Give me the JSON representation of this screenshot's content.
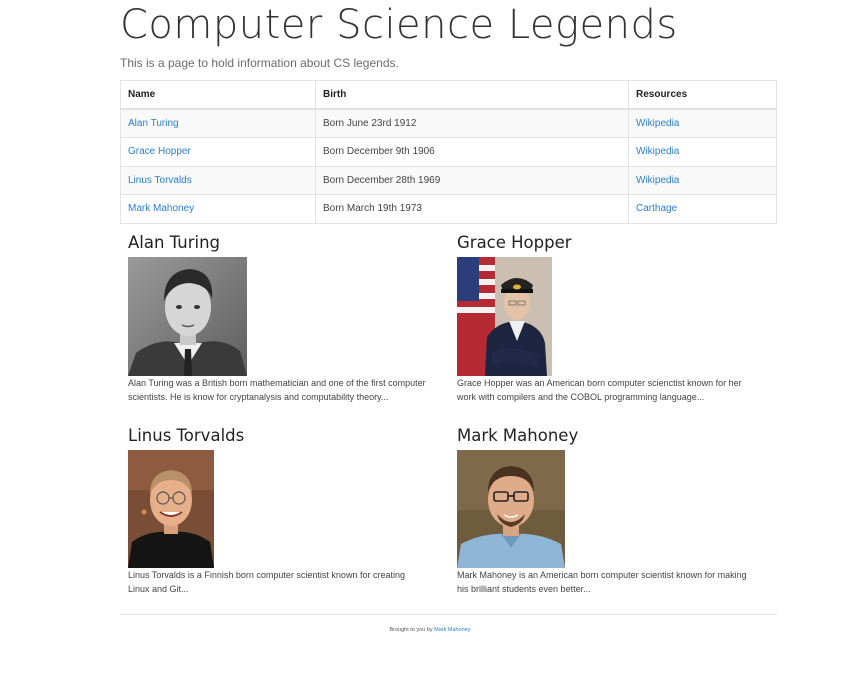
{
  "header": {
    "title": "Computer Science Legends",
    "subtitle": "This is a page to hold information about CS legends."
  },
  "table": {
    "headers": [
      "Name",
      "Birth",
      "Resources"
    ],
    "rows": [
      {
        "name": "Alan Turing",
        "birth": "Born June 23rd 1912",
        "resource": "Wikipedia"
      },
      {
        "name": "Grace Hopper",
        "birth": "Born December 9th 1906",
        "resource": "Wikipedia"
      },
      {
        "name": "Linus Torvalds",
        "birth": "Born December 28th 1969",
        "resource": "Wikipedia"
      },
      {
        "name": "Mark Mahoney",
        "birth": "Born March 19th 1973",
        "resource": "Carthage"
      }
    ]
  },
  "bios": [
    {
      "name": "Alan Turing",
      "text": "Alan Turing was a British born mathematician and one of the first computer scientists. He is know for cryptanalysis and computability theory..."
    },
    {
      "name": "Grace Hopper",
      "text": "Grace Hopper was an American born computer scienctist known for her work with compilers and the COBOL programming language..."
    },
    {
      "name": "Linus Torvalds",
      "text": "Linus Torvalds is a Finnish born computer scientist known for creating Linux and Git..."
    },
    {
      "name": "Mark Mahoney",
      "text": "Mark Mahoney is an American born computer scientist known for making his brilliant students even better..."
    }
  ],
  "footer": {
    "prefix": "Brought to you by",
    "link": "Mark Mahoney"
  },
  "colors": {
    "link": "#2a7fd4",
    "border": "#e3e3e3"
  }
}
